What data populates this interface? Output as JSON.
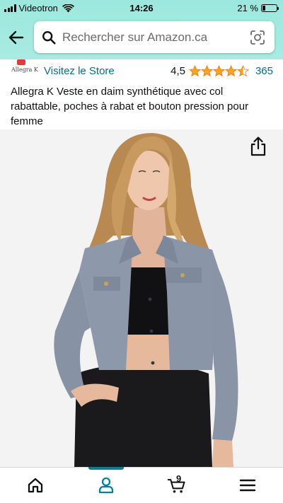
{
  "status_bar": {
    "carrier": "Videotron",
    "time": "14:26",
    "battery": "21 %",
    "battery_level": 0.21
  },
  "search": {
    "placeholder": "Rechercher sur Amazon.ca"
  },
  "store": {
    "logo_text": "Allegra K",
    "visit_label": "Visitez le Store",
    "rating": "4,5",
    "rating_value": 4.5,
    "review_count": "365"
  },
  "product": {
    "title": "Allegra K Veste en daim synthétique avec col rabattable, poches à rabat et bouton pression pour femme"
  },
  "bottom_nav": {
    "cart_count": "9",
    "active_tab": "account"
  },
  "colors": {
    "header_bg": "#a2e9df",
    "link": "#007185",
    "star": "#ffa41c",
    "active_indicator": "#008296"
  }
}
